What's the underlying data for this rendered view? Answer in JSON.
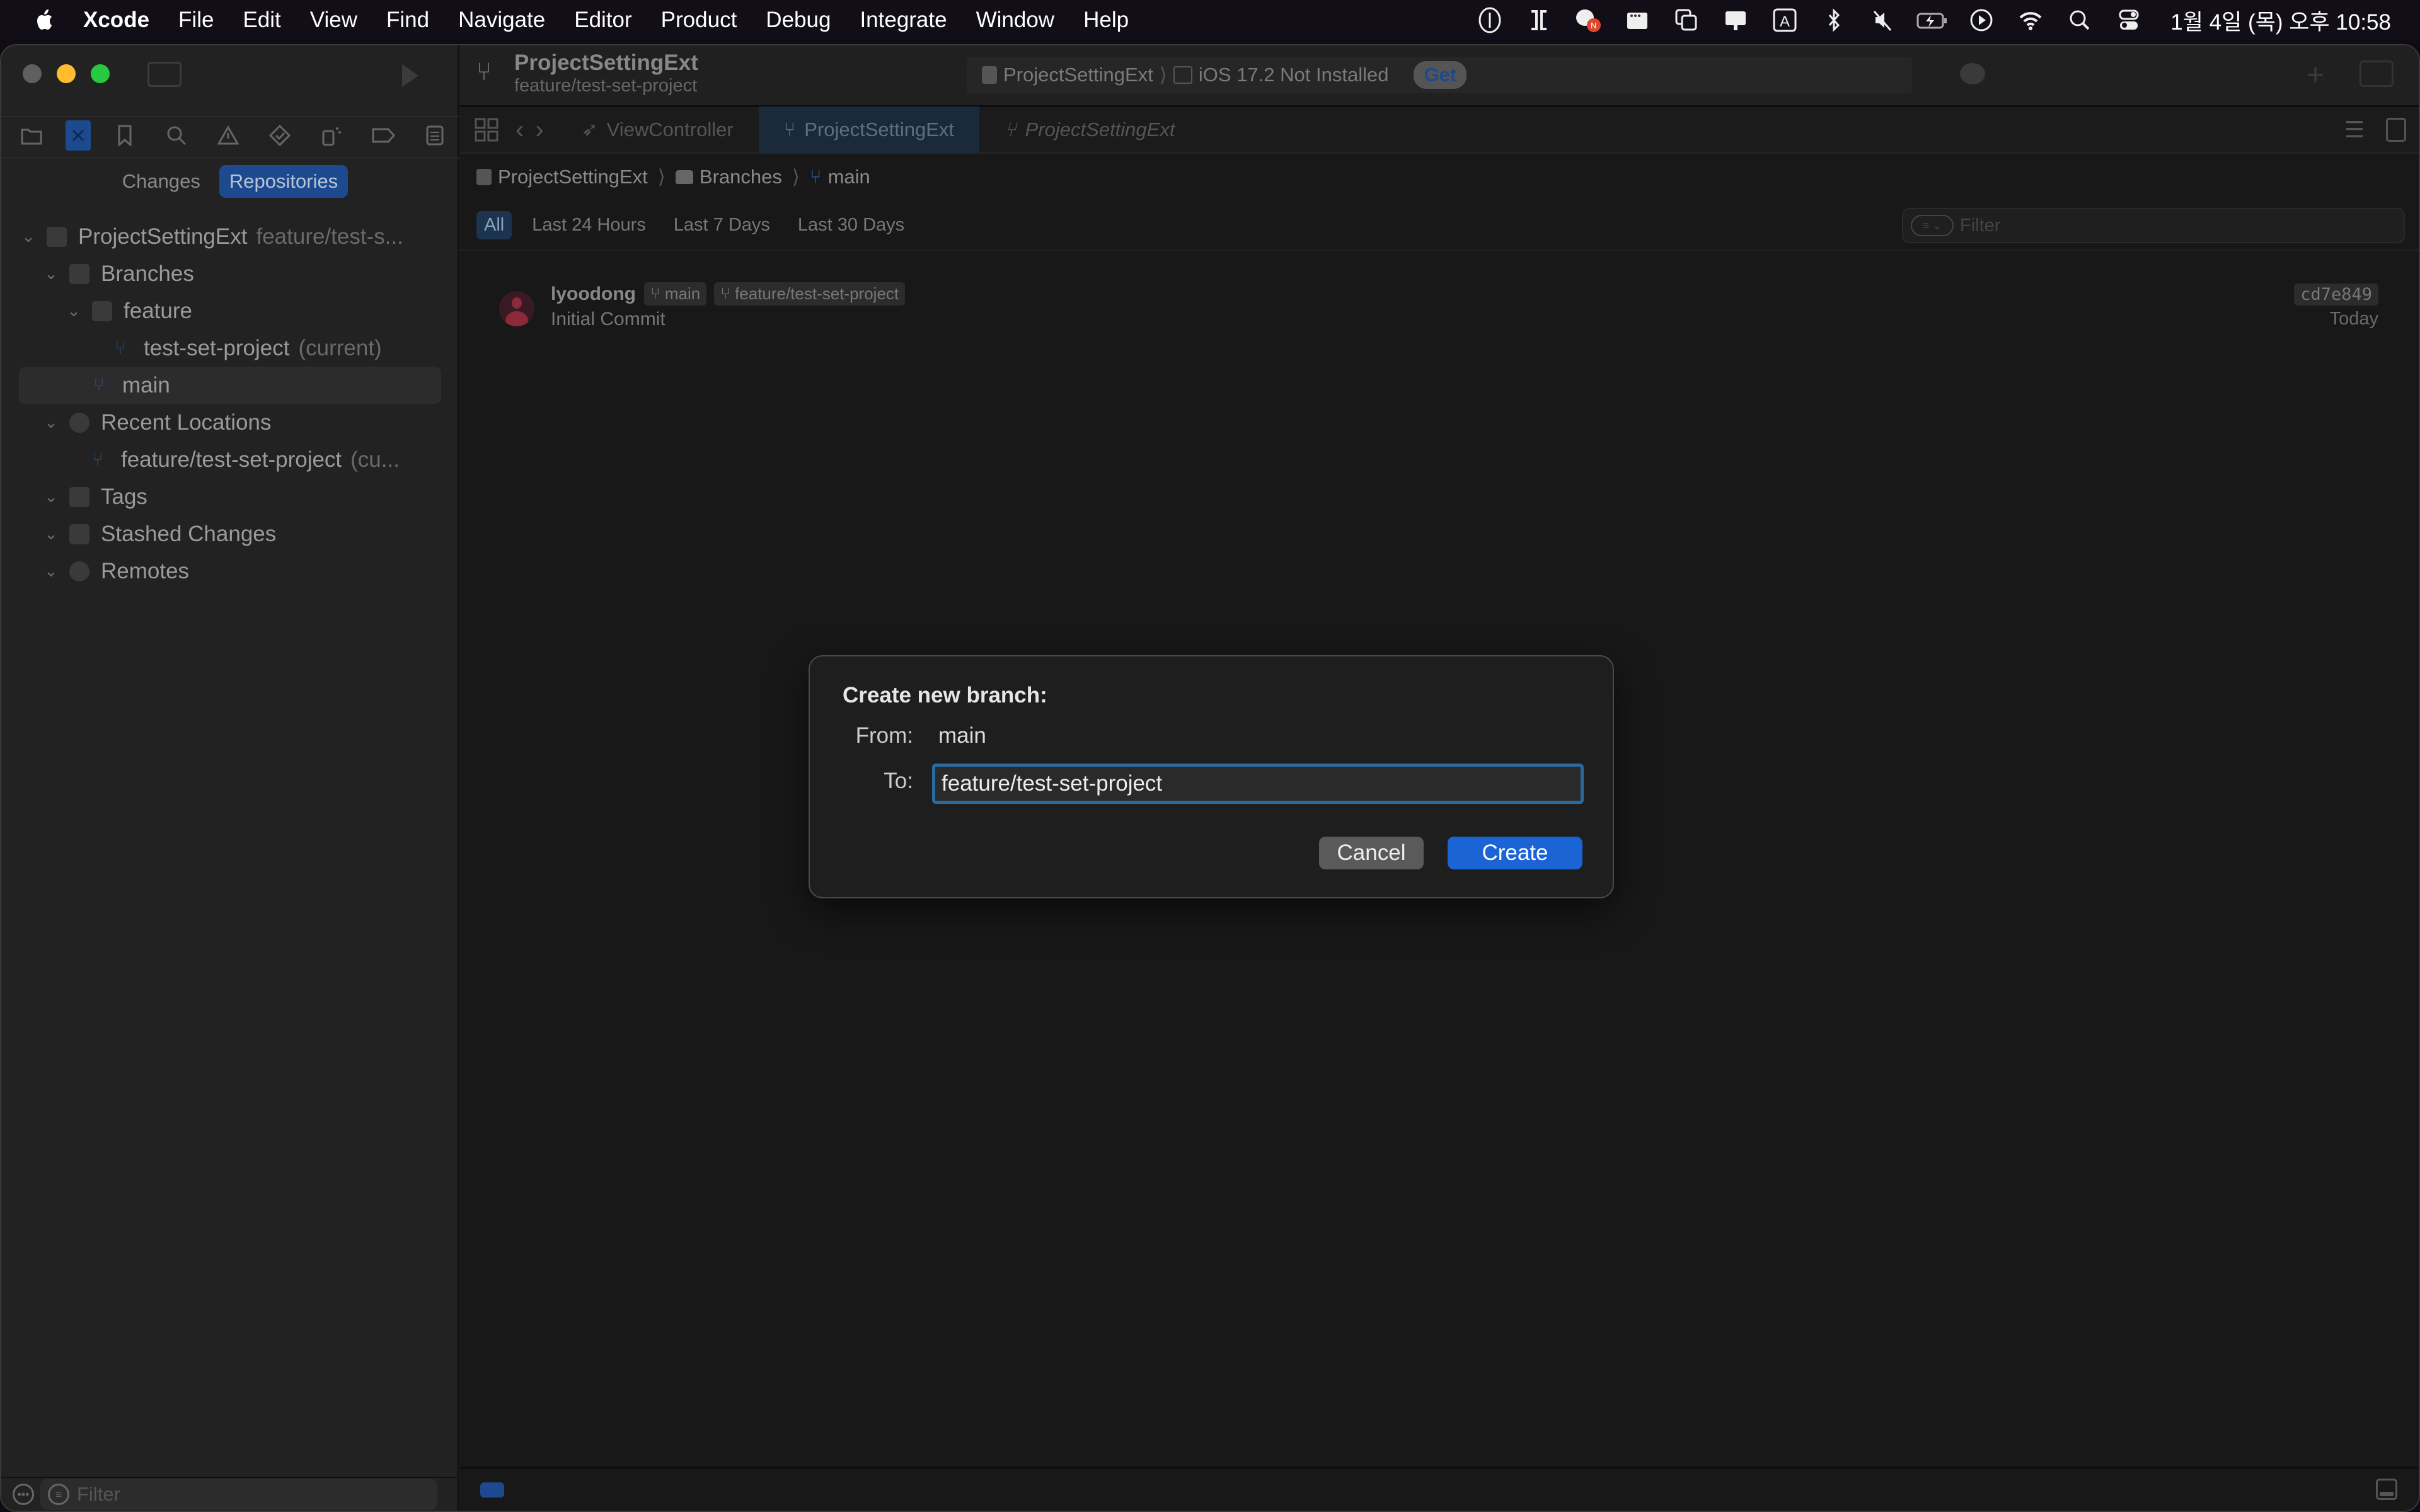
{
  "menubar": {
    "app": "Xcode",
    "items": [
      "File",
      "Edit",
      "View",
      "Find",
      "Navigate",
      "Editor",
      "Product",
      "Debug",
      "Integrate",
      "Window",
      "Help"
    ],
    "status_icons": [
      "microphone-icon",
      "bracket-app-icon",
      "chat-notification-icon",
      "menu-extra-icon",
      "window-stack-icon",
      "display-icon",
      "input-source-icon",
      "bluetooth-icon",
      "mute-icon",
      "battery-charging-icon",
      "play-circle-icon",
      "wifi-icon",
      "spotlight-search-icon",
      "control-center-icon"
    ],
    "input_source": "A",
    "notification_badge": "N",
    "clock": "1월 4일 (목) 오후 10:58"
  },
  "sidebar": {
    "segments": {
      "changes": "Changes",
      "repositories": "Repositories"
    },
    "tree": {
      "project": {
        "name": "ProjectSettingExt",
        "branch": "feature/test-s..."
      },
      "branches": "Branches",
      "feature_folder": "feature",
      "current_branch": {
        "name": "test-set-project",
        "note": "(current)"
      },
      "main_branch": "main",
      "recent_locations": "Recent Locations",
      "recent_item": {
        "name": "feature/test-set-project",
        "note": "(cu..."
      },
      "tags": "Tags",
      "stashed": "Stashed Changes",
      "remotes": "Remotes"
    },
    "filter_placeholder": "Filter"
  },
  "toolbar": {
    "title": "ProjectSettingExt",
    "subtitle": "feature/test-set-project",
    "scheme": "ProjectSettingExt",
    "destination": "iOS 17.2 Not Installed",
    "get_label": "Get"
  },
  "tabs": [
    {
      "label": "ViewController"
    },
    {
      "label": "ProjectSettingExt"
    },
    {
      "label": "ProjectSettingExt"
    }
  ],
  "jumpbar": {
    "project": "ProjectSettingExt",
    "group": "Branches",
    "branch": "main"
  },
  "time_filters": [
    "All",
    "Last 24 Hours",
    "Last 7 Days",
    "Last 30 Days"
  ],
  "filter_placeholder": "Filter",
  "commit": {
    "author": "lyoodong",
    "tags": [
      "main",
      "feature/test-set-project"
    ],
    "message": "Initial Commit",
    "hash": "cd7e849",
    "date": "Today"
  },
  "dialog": {
    "title": "Create new branch:",
    "from_label": "From:",
    "from_value": "main",
    "to_label": "To:",
    "to_value": "feature/test-set-project",
    "cancel": "Cancel",
    "create": "Create"
  },
  "colors": {
    "accent": "#1a64d6",
    "selection": "#1d4a8e",
    "focus_ring": "#2b6a9e"
  }
}
